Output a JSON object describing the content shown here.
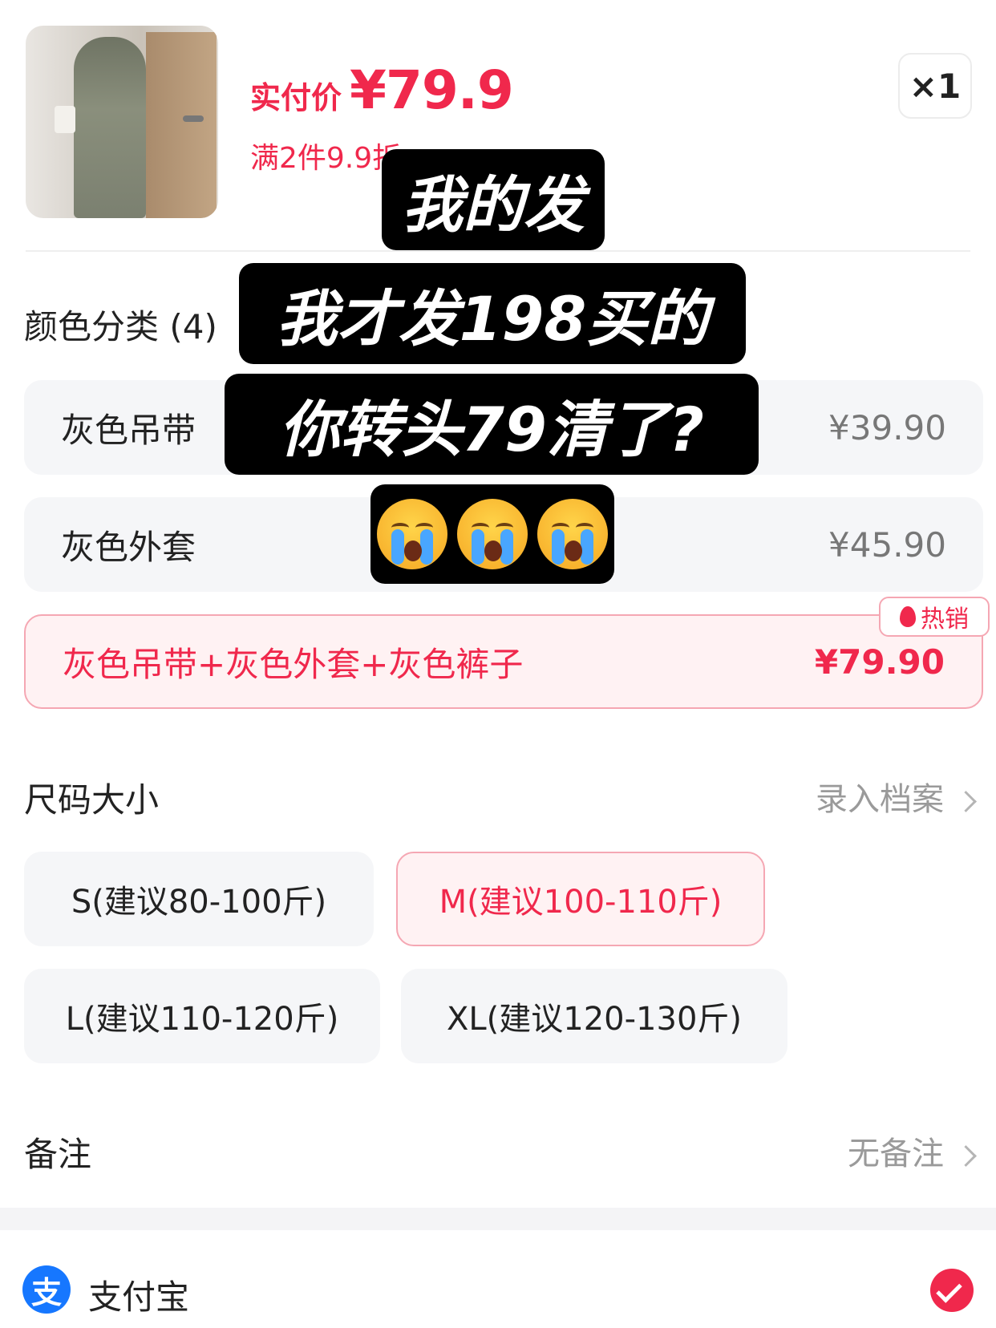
{
  "product": {
    "price_label": "实付价",
    "price_value": "¥79.9",
    "discount_text": "满2件9.9折 ›",
    "quantity": "×1"
  },
  "color_section": {
    "title": "颜色分类 (4)",
    "options": [
      {
        "label": "灰色吊带",
        "price": "¥39.90"
      },
      {
        "label": "灰色外套",
        "price": "¥45.90"
      },
      {
        "label": "灰色吊带+灰色外套+灰色裤子",
        "price": "¥79.90",
        "badge": "热销"
      }
    ]
  },
  "size_section": {
    "title": "尺码大小",
    "link": "录入档案",
    "options": [
      "S(建议80-100斤)",
      "M(建议100-110斤)",
      "L(建议110-120斤)",
      "XL(建议120-130斤)"
    ],
    "selected": "M(建议100-110斤)"
  },
  "remark": {
    "title": "备注",
    "value": "无备注"
  },
  "payment": {
    "icon_glyph": "支",
    "method": "支付宝"
  },
  "overlay": {
    "line1": "我的发",
    "line2": "我才发198买的",
    "line3": "你转头79清了?"
  },
  "colors": {
    "accent": "#f0284c",
    "alipay": "#1677ff"
  }
}
